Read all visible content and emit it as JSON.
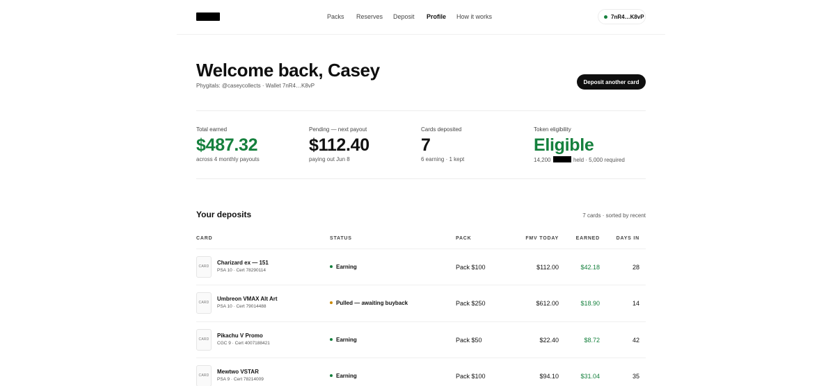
{
  "nav": {
    "items": [
      {
        "label": "Packs",
        "active": false
      },
      {
        "label": "Reserves",
        "active": false
      },
      {
        "label": "Deposit",
        "active": false
      },
      {
        "label": "Profile",
        "active": true
      },
      {
        "label": "How it works",
        "active": false
      }
    ],
    "wallet": "7nR4…K8vP"
  },
  "hero": {
    "title": "Welcome back, Casey",
    "subtitle": "Phygitals: @caseycollects · Wallet 7nR4…K8vP",
    "cta": "Deposit another card"
  },
  "stats": [
    {
      "label": "Total earned",
      "value": "$487.32",
      "note": "across 4 monthly payouts",
      "accent": "green"
    },
    {
      "label": "Pending — next payout",
      "value": "$112.40",
      "note": "paying out Jun 8",
      "accent": "dark"
    },
    {
      "label": "Cards deposited",
      "value": "7",
      "note": "6 earning · 1 kept",
      "accent": "dark"
    },
    {
      "label": "Token eligibility",
      "value": "Eligible",
      "note_prefix": "14,200",
      "note_suffix": "held · 5,000 required",
      "accent": "green"
    }
  ],
  "deposits": {
    "title": "Your deposits",
    "meta": "7 cards · sorted by recent",
    "columns": [
      "CARD",
      "STATUS",
      "PACK",
      "FMV TODAY",
      "EARNED",
      "DAYS IN"
    ],
    "thumb_label": "CARD",
    "rows": [
      {
        "name": "Charizard ex — 151",
        "cert": "PSA 10 · Cert 78290114",
        "status": "Earning",
        "status_color": "#15803d",
        "pack": "Pack $100",
        "fmv": "$112.00",
        "earned": "$42.18",
        "days": "28"
      },
      {
        "name": "Umbreon VMAX Alt Art",
        "cert": "PSA 10 · Cert 79014488",
        "status": "Pulled — awaiting buyback",
        "status_color": "#ca8a04",
        "pack": "Pack $250",
        "fmv": "$612.00",
        "earned": "$18.90",
        "days": "14"
      },
      {
        "name": "Pikachu V Promo",
        "cert": "CGC 9 · Cert 4007188421",
        "status": "Earning",
        "status_color": "#15803d",
        "pack": "Pack $50",
        "fmv": "$22.40",
        "earned": "$8.72",
        "days": "42"
      },
      {
        "name": "Mewtwo VSTAR",
        "cert": "PSA 9 · Cert 78214009",
        "status": "Earning",
        "status_color": "#15803d",
        "pack": "Pack $100",
        "fmv": "$94.10",
        "earned": "$31.04",
        "days": "35"
      }
    ]
  },
  "colors": {
    "accent_green": "#15803d",
    "status_pending": "#ca8a04",
    "text": "#111111"
  }
}
